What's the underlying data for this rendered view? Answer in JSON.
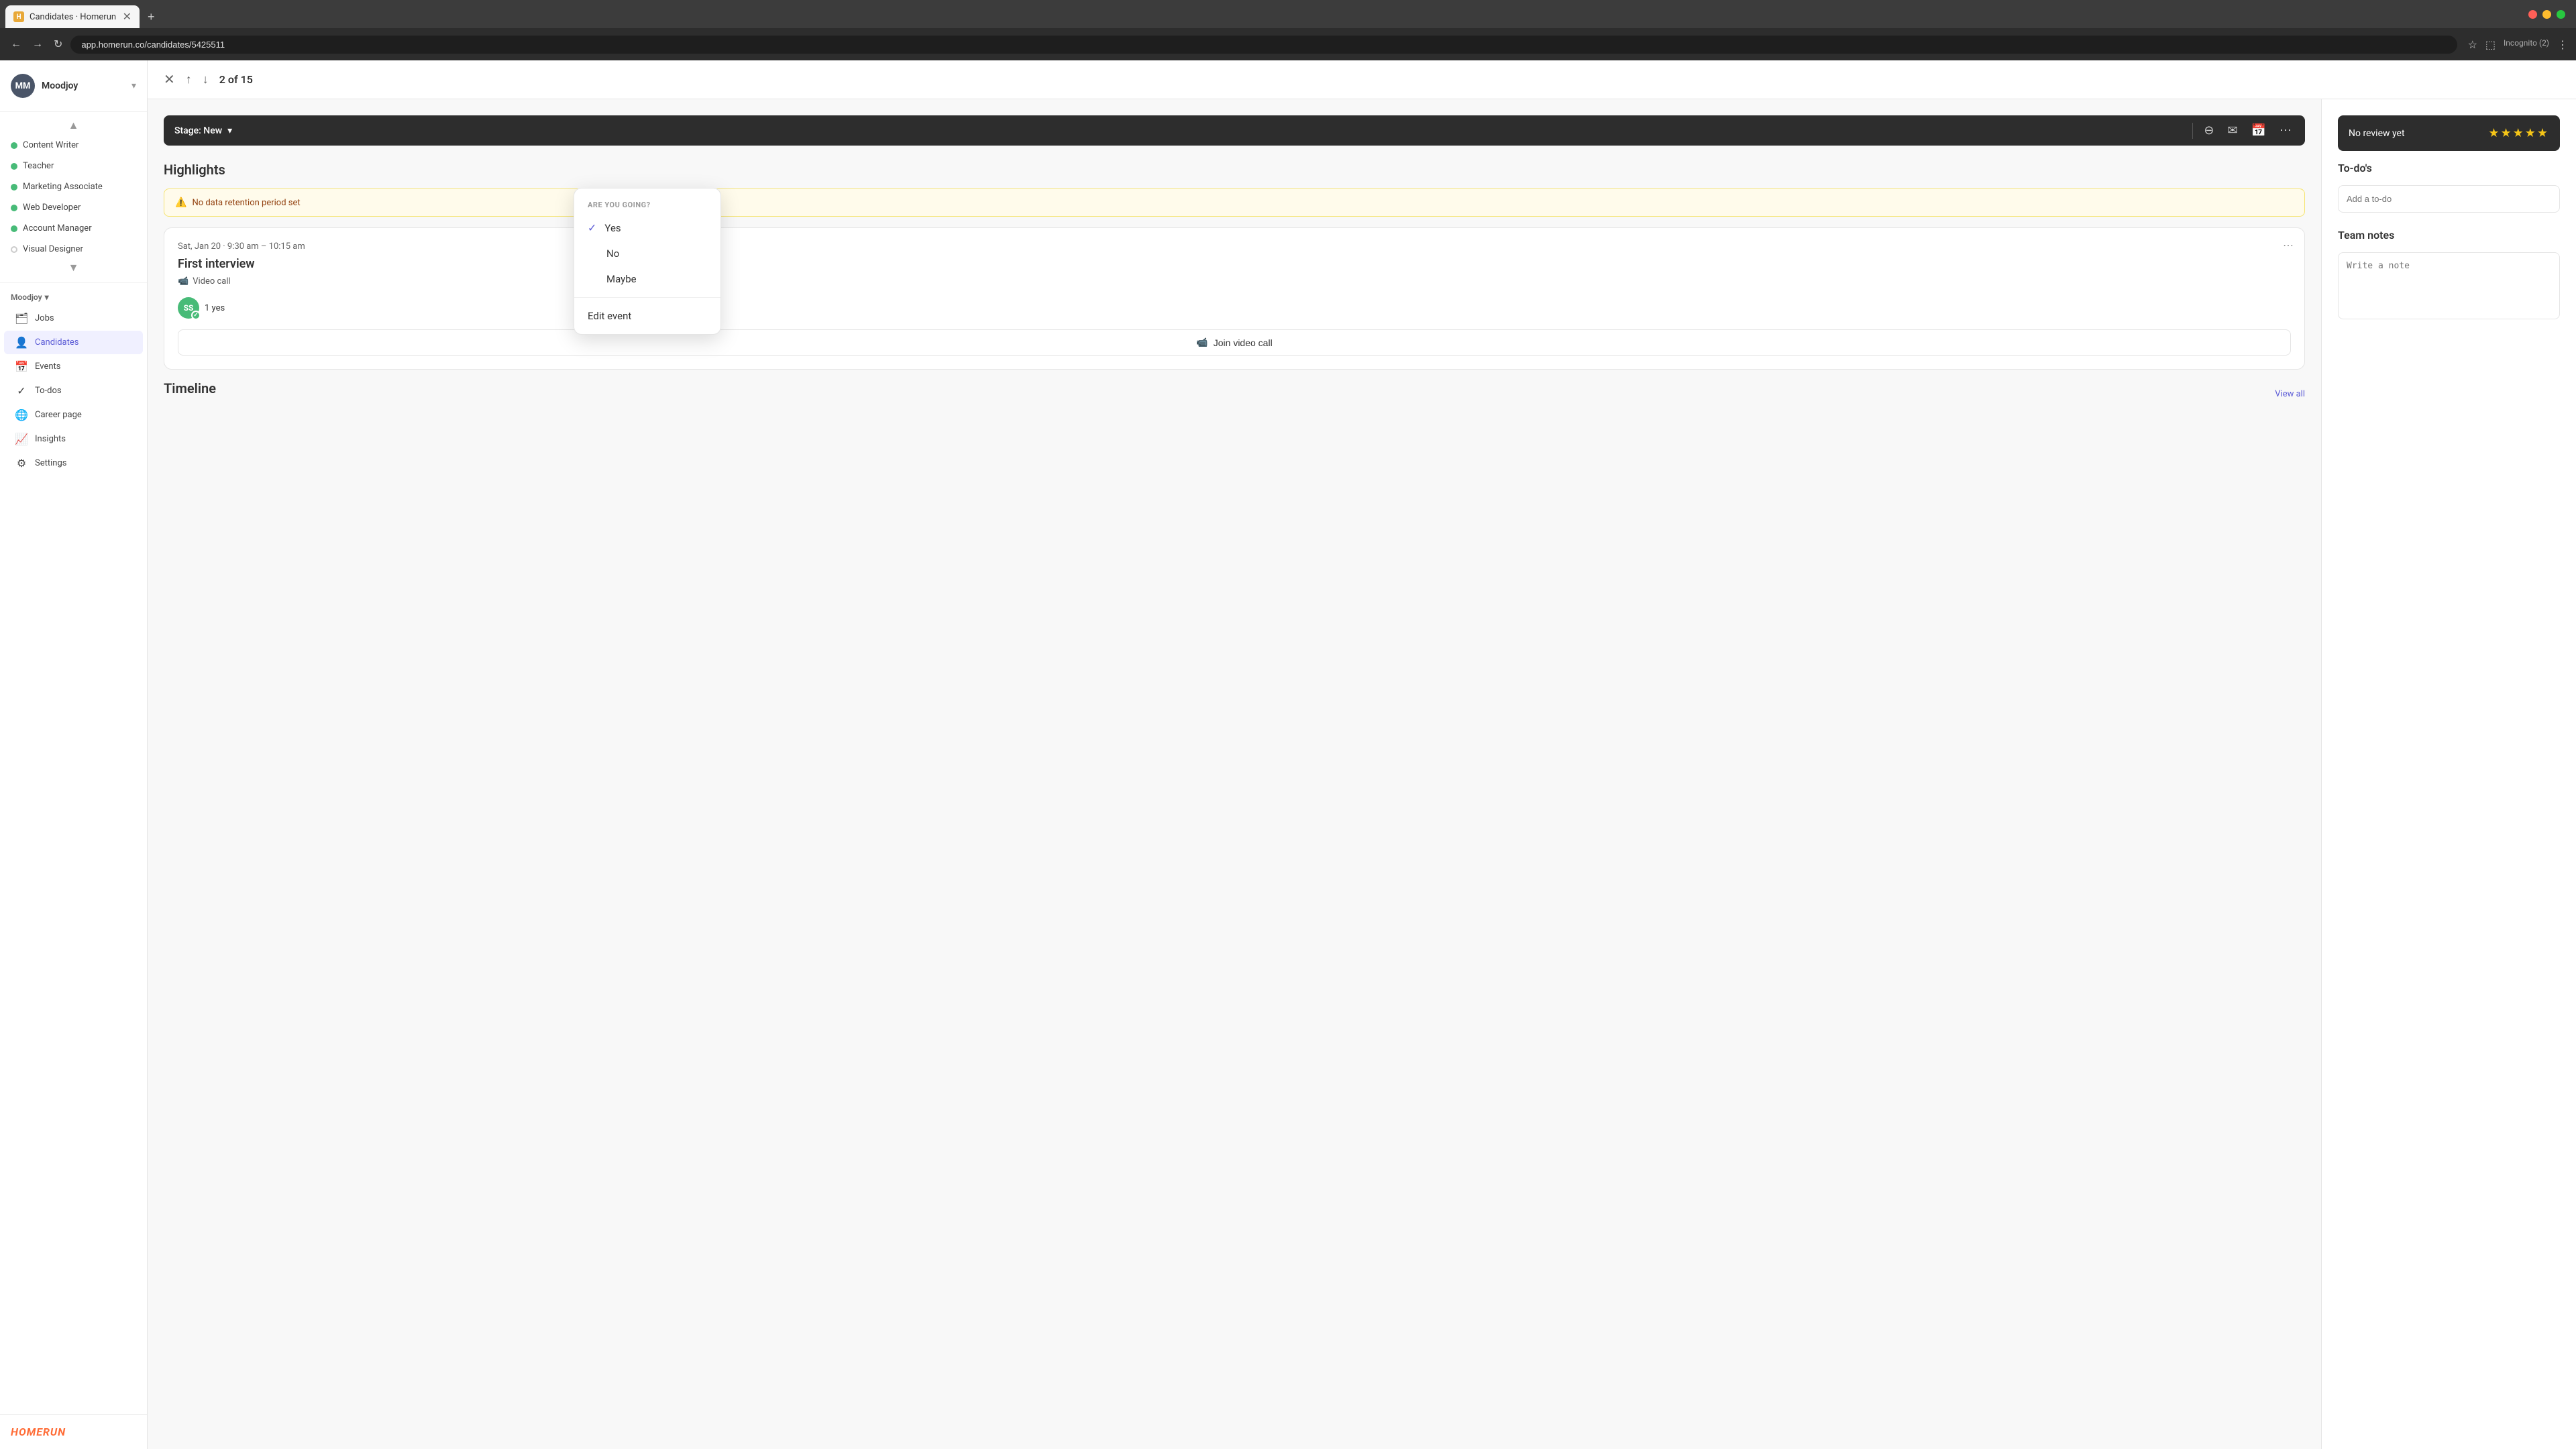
{
  "browser": {
    "tab_title": "Candidates · Homerun",
    "url": "app.homerun.co/candidates/5425511",
    "incognito_label": "Incognito (2)"
  },
  "sidebar": {
    "org_name": "Moodjoy",
    "avatar_initials": "MM",
    "jobs": [
      {
        "name": "Content Writer",
        "color": "#48bb78",
        "active": false
      },
      {
        "name": "Teacher",
        "color": "#48bb78",
        "active": false
      },
      {
        "name": "Marketing Associate",
        "color": "#48bb78",
        "active": false
      },
      {
        "name": "Web Developer",
        "color": "#48bb78",
        "active": false
      },
      {
        "name": "Account Manager",
        "color": "#48bb78",
        "active": false
      },
      {
        "name": "Visual Designer",
        "color": "#cccccc",
        "active": false,
        "dotStyle": "outline"
      }
    ],
    "org_label": "Moodjoy",
    "nav_items": [
      {
        "icon": "🗂",
        "label": "Jobs",
        "active": false
      },
      {
        "icon": "👤",
        "label": "Candidates",
        "active": true
      },
      {
        "icon": "📅",
        "label": "Events",
        "active": false
      },
      {
        "icon": "✓",
        "label": "To-dos",
        "active": false
      },
      {
        "icon": "🌐",
        "label": "Career page",
        "active": false
      },
      {
        "icon": "📈",
        "label": "Insights",
        "active": false
      },
      {
        "icon": "⚙",
        "label": "Settings",
        "active": false
      }
    ],
    "logo": "HOMERUN"
  },
  "topbar": {
    "counter": "2 of 15"
  },
  "stage_toolbar": {
    "stage_label": "Stage: New",
    "dropdown_icon": "▾"
  },
  "main": {
    "highlights_title": "Highlights",
    "warning_text": "No data retention period set",
    "interview": {
      "date": "Sat, Jan 20 · 9:30 am – 10:15 am",
      "title": "First interview",
      "video_label": "Video call",
      "attendee_initials": "SS",
      "yes_count": "1 yes",
      "join_call_label": "Join video call"
    },
    "timeline_title": "Timeline",
    "view_all": "View all"
  },
  "right_panel": {
    "no_review_text": "No review yet",
    "stars": "★★★★★",
    "todos_title": "To-do's",
    "add_todo_placeholder": "Add a to-do",
    "team_notes_title": "Team notes",
    "write_note_placeholder": "Write a note"
  },
  "dropdown_menu": {
    "section_title": "ARE YOU GOING?",
    "items": [
      {
        "label": "Yes",
        "checked": true
      },
      {
        "label": "No",
        "checked": false
      },
      {
        "label": "Maybe",
        "checked": false
      }
    ],
    "edit_label": "Edit event"
  }
}
